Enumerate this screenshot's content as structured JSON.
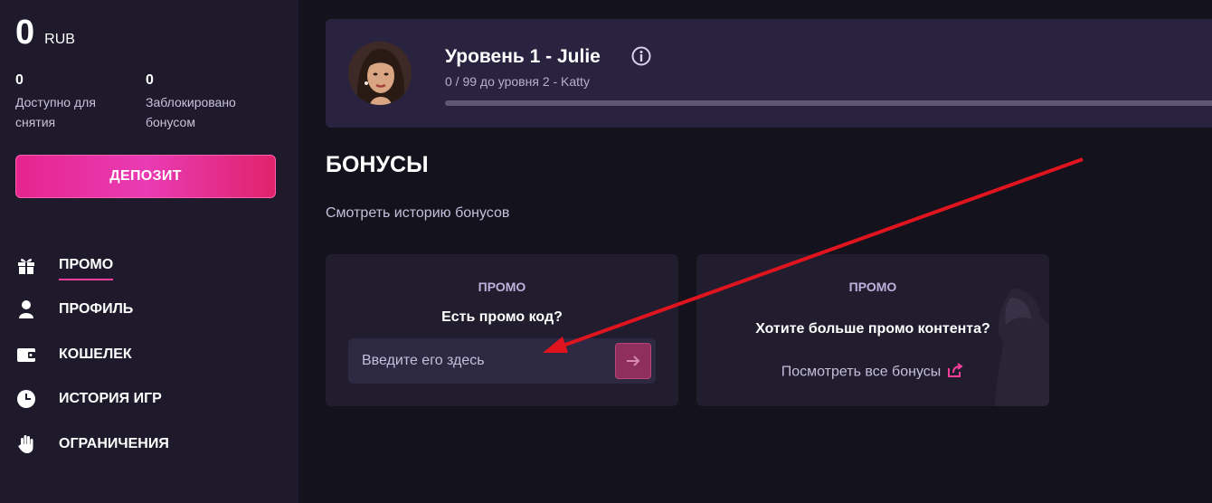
{
  "balance": {
    "amount": "0",
    "currency": "RUB"
  },
  "stats": [
    {
      "value": "0",
      "label_line1": "Доступно для",
      "label_line2": "снятия"
    },
    {
      "value": "0",
      "label_line1": "Заблокировано",
      "label_line2": "бонусом"
    }
  ],
  "deposit_label": "Депозит",
  "nav": [
    {
      "label": "Промо",
      "icon": "gift-icon",
      "active": true
    },
    {
      "label": "Профиль",
      "icon": "user-icon"
    },
    {
      "label": "Кошелек",
      "icon": "wallet-icon"
    },
    {
      "label": "История игр",
      "icon": "clock-icon"
    },
    {
      "label": "Ограничения",
      "icon": "hand-icon"
    }
  ],
  "level": {
    "title": "Уровень 1 - Julie",
    "subtitle": "0 / 99 до уровня 2 - Katty",
    "progress": 0
  },
  "section_title": "Бонусы",
  "history_link": "Смотреть историю бонусов",
  "promo_code_card": {
    "tag": "ПРОМО",
    "question": "Есть промо код?",
    "input_placeholder": "Введите его здесь"
  },
  "promo_content_card": {
    "tag": "ПРОМО",
    "question": "Хотите больше промо контента?",
    "link": "Посмотреть все бонусы"
  },
  "colors": {
    "accent": "#ff3d9a",
    "sidebar_bg": "#1e1a2c",
    "page_bg": "#14121c",
    "annotation_arrow": "#e0141e"
  }
}
